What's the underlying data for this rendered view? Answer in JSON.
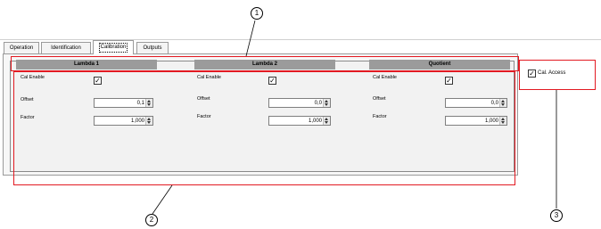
{
  "tabs": [
    {
      "label": "Operation",
      "active": false
    },
    {
      "label": "Identification",
      "active": false
    },
    {
      "label": "Calibration",
      "active": true
    },
    {
      "label": "Outputs",
      "active": false
    }
  ],
  "columns": [
    {
      "header": "Lambda 1",
      "cal_enable_label": "Cal Enable",
      "cal_enable_checked": true,
      "offset_label": "Offset",
      "offset_value": "0,1",
      "factor_label": "Factor",
      "factor_value": "1,000"
    },
    {
      "header": "Lambda 2",
      "cal_enable_label": "Cal Enable",
      "cal_enable_checked": true,
      "offset_label": "Offset",
      "offset_value": "0,0",
      "factor_label": "Factor",
      "factor_value": "1,000"
    },
    {
      "header": "Quotient",
      "cal_enable_label": "Cal Enable",
      "cal_enable_checked": true,
      "offset_label": "Offset",
      "offset_value": "0,0",
      "factor_label": "Factor",
      "factor_value": "1,000"
    }
  ],
  "cal_access": {
    "label": "Cal. Access",
    "checked": true
  },
  "callouts": {
    "one": "1",
    "two": "2",
    "three": "3"
  },
  "colors": {
    "highlight": "#e21a22",
    "header_bar": "#9b9b9b"
  }
}
